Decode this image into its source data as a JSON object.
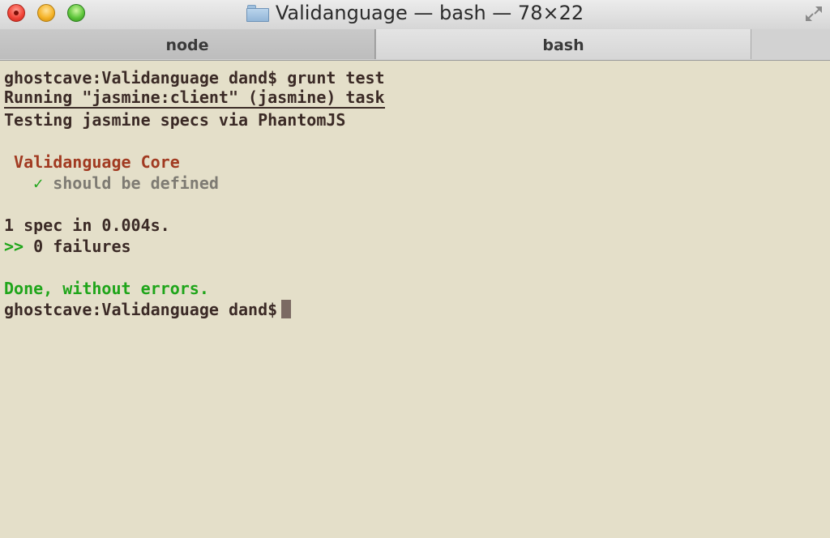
{
  "window": {
    "title": "Validanguage — bash — 78×22",
    "title_icon": "folder-icon",
    "traffic_lights": [
      "close",
      "minimize",
      "zoom"
    ],
    "fullscreen_icon": "fullscreen-arrows-icon"
  },
  "tabs": [
    {
      "label": "node",
      "active": false
    },
    {
      "label": "bash",
      "active": true
    }
  ],
  "terminal": {
    "background": "#e4dfc9",
    "text_color": "#3b2a26",
    "lines": {
      "cmd": "ghostcave:Validanguage dand$ grunt test",
      "running": "Running \"jasmine:client\" (jasmine) task",
      "testing": "Testing jasmine specs via PhantomJS",
      "suite": "Validanguage Core",
      "check": "✓",
      "spec": "should be defined",
      "summary": "1 spec in 0.004s.",
      "prompt_arrows": ">>",
      "failures": "0 failures",
      "done": "Done, without errors.",
      "prompt": "ghostcave:Validanguage dand$"
    },
    "colors": {
      "success": "#1fa51a",
      "suite": "#a13a21",
      "spec": "#7e7b73"
    }
  }
}
